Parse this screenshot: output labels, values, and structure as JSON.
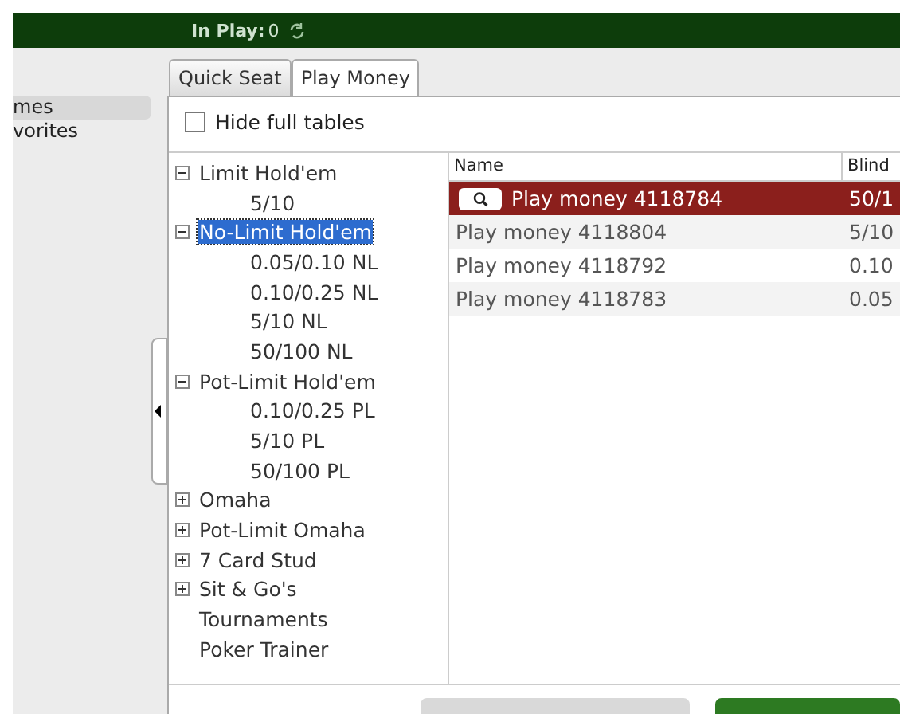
{
  "top_bar": {
    "label": "In Play:",
    "value": "0"
  },
  "sidebar": {
    "items": [
      {
        "label": "mes",
        "selected": true
      },
      {
        "label": "vorites",
        "selected": false
      }
    ]
  },
  "tabs": [
    {
      "label": "Quick Seat",
      "selected": false
    },
    {
      "label": "Play Money",
      "selected": true
    }
  ],
  "hide_full_tables": {
    "label": "Hide full tables",
    "checked": false
  },
  "tree": [
    {
      "label": "Limit Hold'em",
      "expanded": true,
      "selected": false,
      "children": [
        {
          "label": "5/10",
          "selected": false
        }
      ]
    },
    {
      "label": "No-Limit Hold'em",
      "expanded": true,
      "selected": true,
      "children": [
        {
          "label": "0.05/0.10 NL",
          "selected": false
        },
        {
          "label": "0.10/0.25 NL",
          "selected": false
        },
        {
          "label": "5/10 NL",
          "selected": false
        },
        {
          "label": "50/100 NL",
          "selected": false
        }
      ]
    },
    {
      "label": "Pot-Limit Hold'em",
      "expanded": true,
      "selected": false,
      "children": [
        {
          "label": "0.10/0.25 PL",
          "selected": false
        },
        {
          "label": "5/10 PL",
          "selected": false
        },
        {
          "label": "50/100 PL",
          "selected": false
        }
      ]
    },
    {
      "label": "Omaha",
      "expanded": false,
      "selected": false
    },
    {
      "label": "Pot-Limit Omaha",
      "expanded": false,
      "selected": false
    },
    {
      "label": "7 Card Stud",
      "expanded": false,
      "selected": false
    },
    {
      "label": "Sit & Go's",
      "expanded": false,
      "selected": false
    },
    {
      "label": "Tournaments",
      "kind": "leaf",
      "selected": false
    },
    {
      "label": "Poker Trainer",
      "kind": "leaf",
      "selected": false
    }
  ],
  "table": {
    "columns": [
      "Name",
      "Blind"
    ],
    "rows": [
      {
        "name": "Play money 4118784",
        "blinds": "50/1",
        "selected": true
      },
      {
        "name": "Play money 4118804",
        "blinds": "5/10",
        "selected": false
      },
      {
        "name": "Play money 4118792",
        "blinds": "0.10",
        "selected": false
      },
      {
        "name": "Play money 4118783",
        "blinds": "0.05",
        "selected": false
      }
    ]
  },
  "bottom_buttons": [
    {
      "disabled": true
    },
    {
      "disabled": false
    }
  ]
}
